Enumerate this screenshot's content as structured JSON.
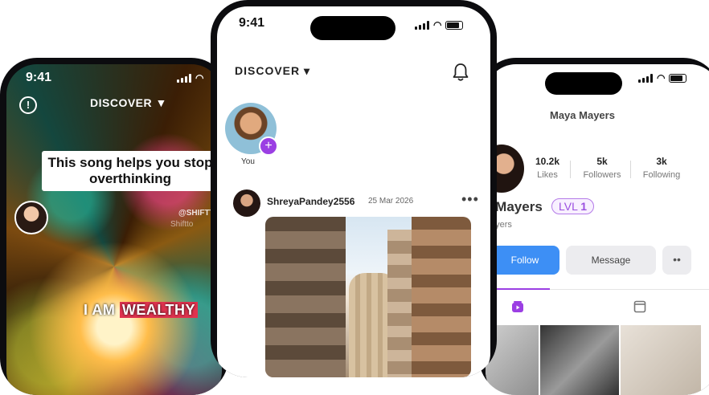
{
  "left_phone": {
    "status_time": "9:41",
    "header_title": "DISCOVER",
    "header_caret": "▼",
    "info_icon": "info-icon",
    "caption": "This song helps you stop overthinking",
    "creator_handle": "@SHIFTTO_",
    "creator_sub": "Shiftto",
    "overlay_prefix": "I AM",
    "overlay_highlight": "WEALTHY",
    "highlight_color": "#e0334f"
  },
  "middle_phone": {
    "status_time": "9:41",
    "header_title": "DISCOVER",
    "header_caret": "▾",
    "bell_icon": "bell-icon",
    "story": {
      "label": "You",
      "plus": "+"
    },
    "post": {
      "username": "ShreyaPandey2556",
      "date": "25 Mar 2026",
      "more": "•••"
    }
  },
  "right_phone": {
    "profile_title": "Maya Mayers",
    "stats": [
      {
        "value": "10.2k",
        "label": "Likes"
      },
      {
        "value": "5k",
        "label": "Followers"
      },
      {
        "value": "3k",
        "label": "Following"
      }
    ],
    "name_visible": "a Mayers",
    "level_prefix": "LVL",
    "level_value": "1",
    "handle_visible": "ayers",
    "follow_label": "Follow",
    "message_label": "Message",
    "more_label": "••",
    "accent_color": "#9b3fe3",
    "follow_color": "#3d8ff5"
  }
}
